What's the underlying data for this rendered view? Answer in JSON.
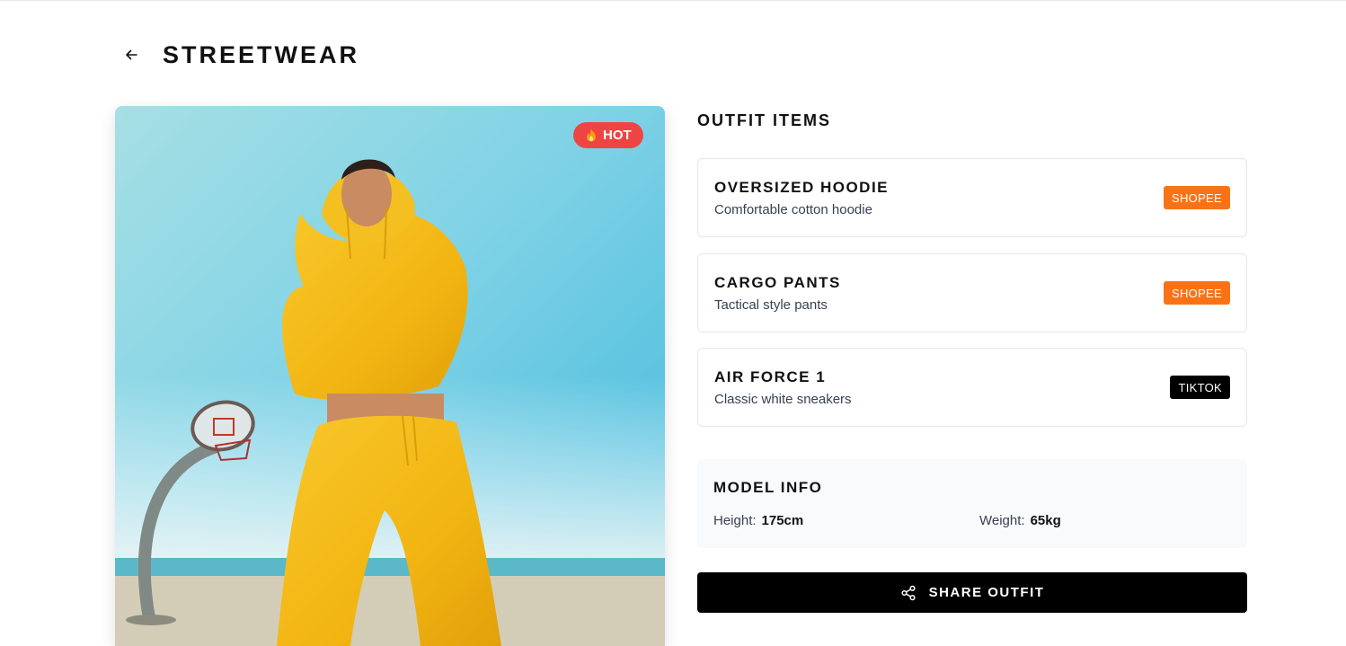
{
  "header": {
    "title": "STREETWEAR",
    "back_icon": "arrow-left-icon"
  },
  "hero": {
    "badge_label": "HOT",
    "badge_icon": "flame-icon",
    "badge_color": "#ef4444"
  },
  "outfit": {
    "title": "OUTFIT ITEMS",
    "items": [
      {
        "name": "OVERSIZED HOODIE",
        "description": "Comfortable cotton hoodie",
        "store": "SHOPEE",
        "store_color": "#f97316"
      },
      {
        "name": "CARGO PANTS",
        "description": "Tactical style pants",
        "store": "SHOPEE",
        "store_color": "#f97316"
      },
      {
        "name": "AIR FORCE 1",
        "description": "Classic white sneakers",
        "store": "TIKTOK",
        "store_color": "#000000"
      }
    ]
  },
  "model_info": {
    "title": "MODEL INFO",
    "height_label": "Height:",
    "height_value": "175cm",
    "weight_label": "Weight:",
    "weight_value": "65kg"
  },
  "share": {
    "label": "SHARE OUTFIT",
    "icon": "share-icon"
  }
}
